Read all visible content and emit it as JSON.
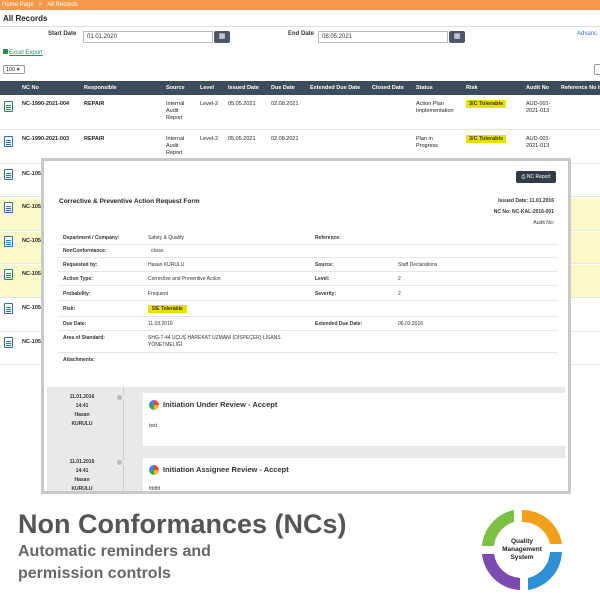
{
  "breadcrumb": [
    "Home Page",
    ">",
    "All Records"
  ],
  "page_title": "All Records",
  "filters": {
    "start_label": "Start Date",
    "start_value": "01.01.2020",
    "end_label": "End Date",
    "end_value": "08.05.2021",
    "advanced_label": "Advanc"
  },
  "excel_export": "Excel Export",
  "page_size": "100",
  "table": {
    "headers": [
      "NC No",
      "Responsible",
      "Source",
      "Level",
      "Issued Date",
      "Due Date",
      "Extended Due Date",
      "Closed Date",
      "Status",
      "Risk",
      "Audit No",
      "Reference No In"
    ],
    "rows": [
      {
        "nc_no": "NC-1990-2021-004",
        "responsible": "REPAIR",
        "source": "Internal Audit Report",
        "level": "Level-2",
        "issued": "05.05.2021",
        "due": "02.08.2021",
        "status": "Action Plan Implementation",
        "risk": "3/C Tolerable",
        "audit": "AUD-001-2021-013"
      },
      {
        "nc_no": "NC-1990-2021-003",
        "responsible": "REPAIR",
        "source": "Internal Audit Report",
        "level": "Level-2",
        "issued": "05.05.2021",
        "due": "02.08.2021",
        "status": "Plan in Progress",
        "risk": "3/C Tolerable",
        "audit": "AUD-001-2021-013"
      },
      {
        "nc_no": "NC-105"
      },
      {
        "nc_no": "NC-105"
      },
      {
        "nc_no": "NC-105"
      },
      {
        "nc_no": "NC-105"
      },
      {
        "nc_no": "NC-105"
      },
      {
        "nc_no": "NC-105"
      }
    ]
  },
  "form": {
    "nc_report_button": "NC Report",
    "title": "Corrective & Preventive Action Request Form",
    "issued_date": "Issued Date: 11.01.2016",
    "nc_no": "NC No: NC-KAL-2016-001",
    "audit_no": "Audit No:",
    "fields": {
      "department_label": "Department / Company:",
      "department_value": "Safety & Quality",
      "reference_label": "Reference:",
      "nonconformance_label": "NonConformance:",
      "nonconformance_value": "cksss",
      "requested_by_label": "Requested by:",
      "requested_by_value": "Hasan KURULU",
      "source_label": "Source:",
      "source_value": "Staff Declarations",
      "action_type_label": "Action Type:",
      "action_type_value": "Corrective and Preventive Action",
      "level_label": "Level:",
      "level_value": "2",
      "probability_label": "Probability:",
      "probability_value": "Frequent",
      "severity_label": "Severity:",
      "severity_value": "2",
      "risk_label": "Risk:",
      "risk_value": "5/E Tolerable",
      "due_date_label": "Due Date:",
      "due_date_value": "11.03.2016",
      "extended_label": "Extended Due Date:",
      "extended_value": "06.02.2016",
      "area_label": "Area of Standard:",
      "area_value_1": "SHG-T-44 UÇUŞ HAREKAT UZMANI (DİSPEÇER) LİSANS",
      "area_value_2": "YÖNETMELİĞİ",
      "attachments_label": "Attachments:"
    }
  },
  "timeline": [
    {
      "date": "11.01.2016",
      "time": "14:41",
      "user_first": "Hasan",
      "user_last": "KURULU",
      "heading": "Initiation Under Review - Accept",
      "body": "test"
    },
    {
      "date": "11.01.2016",
      "time": "14:41",
      "user_first": "Hasan",
      "user_last": "KURULU",
      "heading": "Initiation Assignee Review - Accept",
      "body": "fddfd"
    }
  ],
  "promo": {
    "title": "Non Conformances (NCs)",
    "line1": "Automatic reminders and",
    "line2": "permission controls",
    "logo_text_1": "Quality",
    "logo_text_2": "Management",
    "logo_text_3": "System"
  },
  "colors": {
    "breadcrumb_bg": "#f39a4a",
    "header_bg": "#3e4b5b",
    "risk_yellow": "#e8e000",
    "highlight_row": "#fafac8"
  }
}
